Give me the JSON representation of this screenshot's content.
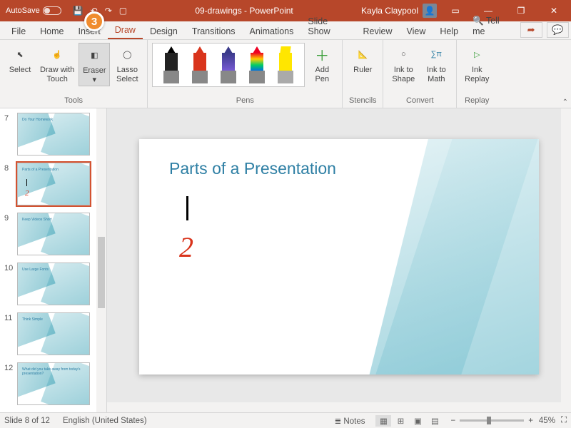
{
  "titlebar": {
    "autosave": "AutoSave",
    "doc": "09-drawings",
    "app": "PowerPoint",
    "user": "Kayla Claypool"
  },
  "step_badge": "3",
  "tabs": {
    "file": "File",
    "home": "Home",
    "insert": "Insert",
    "draw": "Draw",
    "design": "Design",
    "transitions": "Transitions",
    "animations": "Animations",
    "slideshow": "Slide Show",
    "review": "Review",
    "view": "View",
    "help": "Help",
    "tellme": "Tell me"
  },
  "ribbon": {
    "tools": {
      "label": "Tools",
      "select": "Select",
      "draw_touch": "Draw with\nTouch",
      "eraser": "Eraser",
      "lasso": "Lasso\nSelect"
    },
    "pens": {
      "label": "Pens",
      "add_pen": "Add\nPen"
    },
    "stencils": {
      "label": "Stencils",
      "ruler": "Ruler"
    },
    "convert": {
      "label": "Convert",
      "ink_shape": "Ink to\nShape",
      "ink_math": "Ink to\nMath"
    },
    "replay": {
      "label": "Replay",
      "ink_replay": "Ink\nReplay"
    }
  },
  "thumbs": [
    {
      "num": "7",
      "title": "Do Your Homework"
    },
    {
      "num": "8",
      "title": "Parts of a Presentation",
      "selected": true,
      "ink": true
    },
    {
      "num": "9",
      "title": "Keep Videos Short"
    },
    {
      "num": "10",
      "title": "Use Large Fonts"
    },
    {
      "num": "11",
      "title": "Think Simple"
    },
    {
      "num": "12",
      "title": "What did you take away from today's presentation?"
    }
  ],
  "slide": {
    "title": "Parts of a Presentation",
    "ink_z": "2"
  },
  "status": {
    "counter": "Slide 8 of 12",
    "lang": "English (United States)",
    "notes": "Notes",
    "zoom": "45%"
  }
}
